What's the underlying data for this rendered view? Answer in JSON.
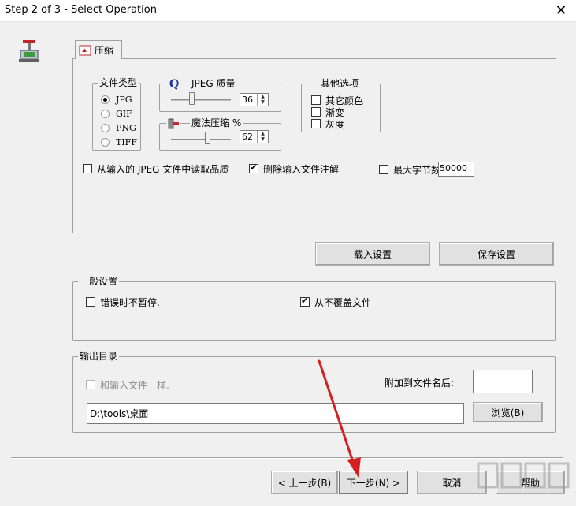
{
  "window": {
    "title": "Step 2 of 3 - Select Operation",
    "close_glyph": "✕"
  },
  "tab": {
    "label": "压缩"
  },
  "file_type": {
    "legend": "文件类型",
    "options": [
      "JPG",
      "GIF",
      "PNG",
      "TIFF"
    ],
    "selected": "JPG"
  },
  "jpeg_quality": {
    "label": "JPEG 质量",
    "value": "36",
    "icon_glyph": "Q",
    "slider_fraction": 0.36
  },
  "magic_compress": {
    "label": "魔法压缩 %",
    "value": "62",
    "slider_fraction": 0.62
  },
  "other_options": {
    "legend": "其他选项",
    "items": [
      {
        "label": "其它颜色",
        "checked": false
      },
      {
        "label": "渐变",
        "checked": false
      },
      {
        "label": "灰度",
        "checked": false
      }
    ]
  },
  "read_quality": {
    "label": "从输入的 JPEG 文件中读取品质",
    "checked": false
  },
  "delete_comments": {
    "label": "删除输入文件注解",
    "checked": true
  },
  "max_bytes": {
    "label": "最大字节数",
    "value": "50000",
    "checked": false
  },
  "load_settings": {
    "label": "载入设置"
  },
  "save_settings": {
    "label": "保存设置"
  },
  "general": {
    "legend": "一般设置",
    "no_pause": {
      "label": "错误时不暂停.",
      "checked": false
    },
    "never_overwrite": {
      "label": "从不覆盖文件",
      "checked": true
    }
  },
  "output": {
    "legend": "输出目录",
    "same_as_input": {
      "label": "和输入文件一样.",
      "checked": false
    },
    "append_label": "附加到文件名后:",
    "append_value": "",
    "path": "D:\\tools\\桌面",
    "browse_label": "浏览(B)"
  },
  "nav": {
    "back_label": "< 上一步(B)",
    "next_label": "下一步(N) >",
    "cancel_label": "取消",
    "help_label": "帮助"
  },
  "colors": {
    "annotation_arrow": "#d42020"
  }
}
